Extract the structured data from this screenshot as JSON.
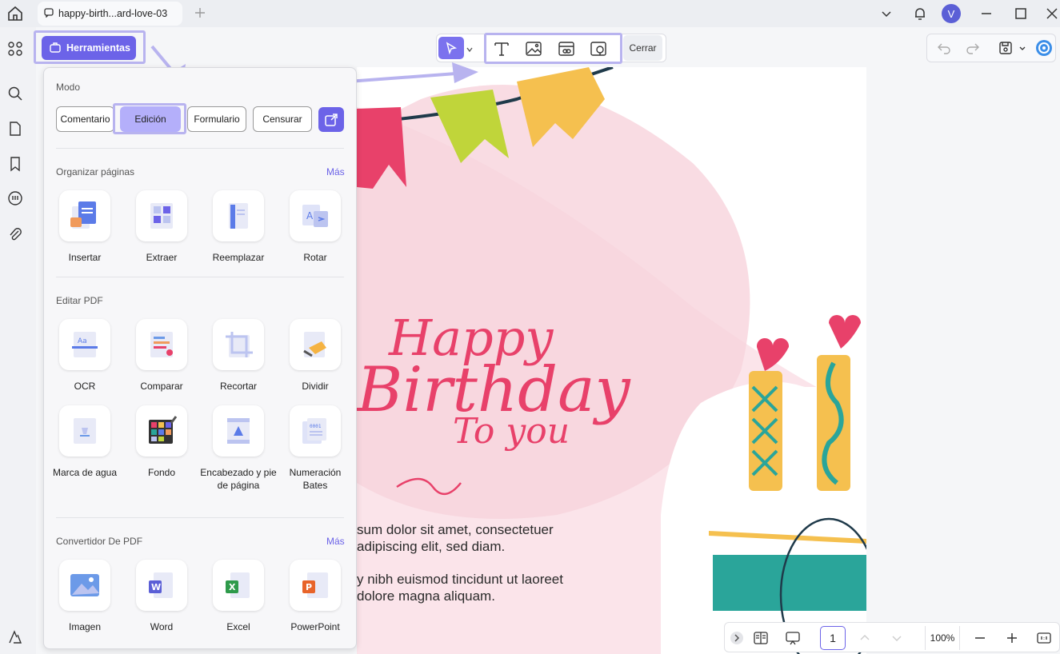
{
  "tab": {
    "title": "happy-birth...ard-love-03"
  },
  "user": {
    "initial": "V"
  },
  "toolbar": {
    "herramientas": "Herramientas",
    "cerrar": "Cerrar"
  },
  "panel": {
    "modo_title": "Modo",
    "modes": [
      "Comentario",
      "Edición",
      "Formulario",
      "Censurar"
    ],
    "active_mode": "Edición",
    "organizar": {
      "title": "Organizar páginas",
      "more": "Más",
      "items": [
        "Insertar",
        "Extraer",
        "Reemplazar",
        "Rotar"
      ]
    },
    "editar": {
      "title": "Editar PDF",
      "items": [
        "OCR",
        "Comparar",
        "Recortar",
        "Dividir",
        "Marca de agua",
        "Fondo",
        "Encabezado y pie de página",
        "Numeración Bates"
      ]
    },
    "convertidor": {
      "title": "Convertidor De PDF",
      "more": "Más",
      "items": [
        "Imagen",
        "Word",
        "Excel",
        "PowerPoint"
      ]
    }
  },
  "document": {
    "lines": [
      "sum dolor sit amet, consectetuer",
      "adipiscing elit, sed diam.",
      "y nibh euismod tincidunt ut laoreet",
      "dolore magna aliquam."
    ]
  },
  "zoombar": {
    "page": "1",
    "zoom": "100%"
  },
  "colors": {
    "accent": "#6c63e8",
    "highlight": "#b8b3ef",
    "pink": "#e8416a",
    "green": "#c0d53a",
    "yellow": "#f5c04f",
    "teal": "#2aa59a"
  }
}
